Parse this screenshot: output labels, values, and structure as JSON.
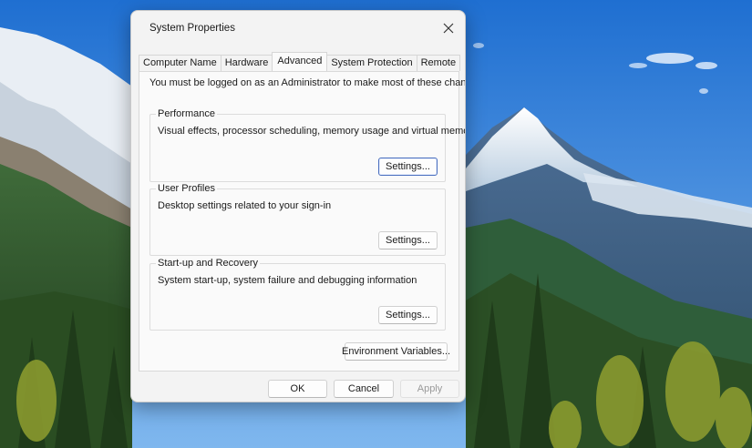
{
  "window": {
    "title": "System Properties"
  },
  "tabs": [
    {
      "label": "Computer Name",
      "active": false
    },
    {
      "label": "Hardware",
      "active": false
    },
    {
      "label": "Advanced",
      "active": true
    },
    {
      "label": "System Protection",
      "active": false
    },
    {
      "label": "Remote",
      "active": false
    }
  ],
  "advanced": {
    "intro": "You must be logged on as an Administrator to make most of these changes.",
    "performance": {
      "label": "Performance",
      "description": "Visual effects, processor scheduling, memory usage and virtual memory",
      "button": "Settings..."
    },
    "user_profiles": {
      "label": "User Profiles",
      "description": "Desktop settings related to your sign-in",
      "button": "Settings..."
    },
    "startup_recovery": {
      "label": "Start-up and Recovery",
      "description": "System start-up, system failure and debugging information",
      "button": "Settings..."
    },
    "env_button": "Environment Variables..."
  },
  "footer": {
    "ok": "OK",
    "cancel": "Cancel",
    "apply": "Apply",
    "apply_enabled": false
  },
  "icons": {
    "close": "close-icon"
  },
  "colors": {
    "sky": "#3f86d8",
    "dialog_bg": "#f3f3f3",
    "default_button_border": "#4a6fbf"
  }
}
